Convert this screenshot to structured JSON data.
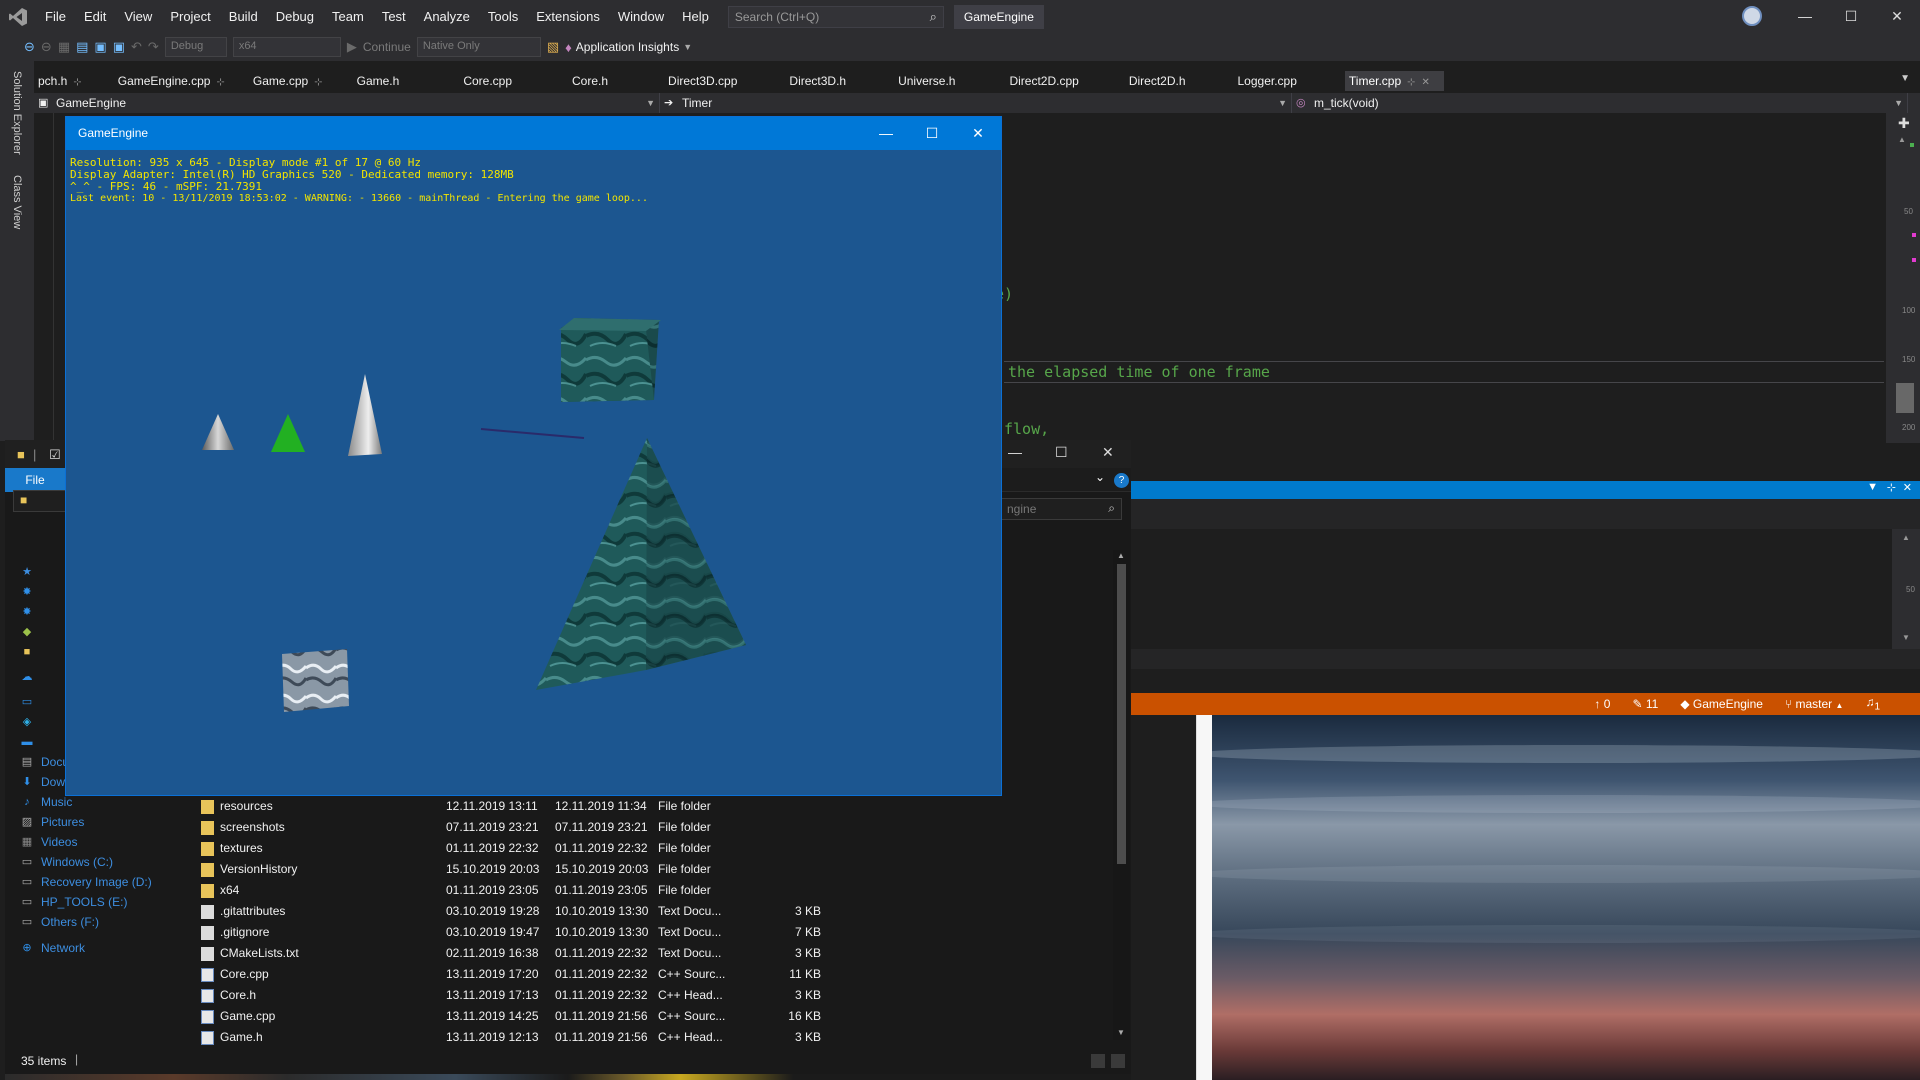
{
  "vs": {
    "menu": [
      "File",
      "Edit",
      "View",
      "Project",
      "Build",
      "Debug",
      "Team",
      "Test",
      "Analyze",
      "Tools",
      "Extensions",
      "Window",
      "Help"
    ],
    "search_placeholder": "Search (Ctrl+Q)",
    "solution_name": "GameEngine",
    "toolbar": {
      "config": "Debug",
      "platform": "x64",
      "continue": "Continue",
      "debugger": "Native Only",
      "app_insights": "Application Insights"
    },
    "side_rail": {
      "solution_explorer": "Solution Explorer",
      "class_view": "Class View"
    },
    "tabs": [
      "pch.h",
      "GameEngine.cpp",
      "Game.cpp",
      "Game.h",
      "Core.cpp",
      "Core.h",
      "Direct3D.cpp",
      "Direct3D.h",
      "Universe.h",
      "Direct2D.cpp",
      "Direct2D.h",
      "Logger.cpp",
      "Timer.cpp"
    ],
    "active_tab": "Timer.cpp",
    "nav": {
      "project": "GameEngine",
      "scope": "Timer",
      "member": "m_tick(void)"
    },
    "code_fragments": [
      "me)",
      "the elapsed time of one frame",
      "flow,"
    ],
    "scroll_ruler": [
      "50",
      "100",
      "150",
      "200"
    ],
    "bottom_ruler": "50",
    "status": {
      "push": "0",
      "changes": "11",
      "repo": "GameEngine",
      "branch": "master",
      "notifications": "1",
      "accent": "#ca5100"
    }
  },
  "game": {
    "title": "GameEngine",
    "hud": {
      "line1": "Resolution: 935 x 645 - Display mode #1 of 17 @ 60 Hz",
      "line2": "Display Adapter: Intel(R) HD Graphics 520 - Dedicated memory: 128MB",
      "line3": "^_^ - FPS: 46 - mSPF: 21.7391",
      "line4": "Last event: 10 - 13/11/2019 18:53:02 - WARNING: - 13660 - mainThread - Entering the game loop..."
    },
    "background": "#1c5690",
    "hud_color": "#f2e400"
  },
  "explorer": {
    "file_tab": "File",
    "search_placeholder": "ngine",
    "nav": [
      "Documents",
      "Downloads",
      "Music",
      "Pictures",
      "Videos",
      "Windows (C:)",
      "Recovery Image (D:)",
      "HP_TOOLS (E:)",
      "Others (F:)",
      "Network"
    ],
    "files": [
      {
        "name": "resources",
        "modified": "12.11.2019 13:11",
        "created": "12.11.2019 11:34",
        "type": "File folder",
        "size": "",
        "kind": "folder"
      },
      {
        "name": "screenshots",
        "modified": "07.11.2019 23:21",
        "created": "07.11.2019 23:21",
        "type": "File folder",
        "size": "",
        "kind": "folder"
      },
      {
        "name": "textures",
        "modified": "01.11.2019 22:32",
        "created": "01.11.2019 22:32",
        "type": "File folder",
        "size": "",
        "kind": "folder"
      },
      {
        "name": "VersionHistory",
        "modified": "15.10.2019 20:03",
        "created": "15.10.2019 20:03",
        "type": "File folder",
        "size": "",
        "kind": "folder"
      },
      {
        "name": "x64",
        "modified": "01.11.2019 23:05",
        "created": "01.11.2019 23:05",
        "type": "File folder",
        "size": "",
        "kind": "folder"
      },
      {
        "name": ".gitattributes",
        "modified": "03.10.2019 19:28",
        "created": "10.10.2019 13:30",
        "type": "Text Docu...",
        "size": "3 KB",
        "kind": "txt"
      },
      {
        "name": ".gitignore",
        "modified": "03.10.2019 19:47",
        "created": "10.10.2019 13:30",
        "type": "Text Docu...",
        "size": "7 KB",
        "kind": "txt"
      },
      {
        "name": "CMakeLists.txt",
        "modified": "02.11.2019 16:38",
        "created": "01.11.2019 22:32",
        "type": "Text Docu...",
        "size": "3 KB",
        "kind": "txt"
      },
      {
        "name": "Core.cpp",
        "modified": "13.11.2019 17:20",
        "created": "01.11.2019 22:32",
        "type": "C++ Sourc...",
        "size": "11 KB",
        "kind": "cpp"
      },
      {
        "name": "Core.h",
        "modified": "13.11.2019 17:13",
        "created": "01.11.2019 22:32",
        "type": "C++ Head...",
        "size": "3 KB",
        "kind": "h"
      },
      {
        "name": "Game.cpp",
        "modified": "13.11.2019 14:25",
        "created": "01.11.2019 21:56",
        "type": "C++ Sourc...",
        "size": "16 KB",
        "kind": "cpp"
      },
      {
        "name": "Game.h",
        "modified": "13.11.2019 12:13",
        "created": "01.11.2019 21:56",
        "type": "C++ Head...",
        "size": "3 KB",
        "kind": "h"
      }
    ],
    "item_count": "35 items"
  }
}
